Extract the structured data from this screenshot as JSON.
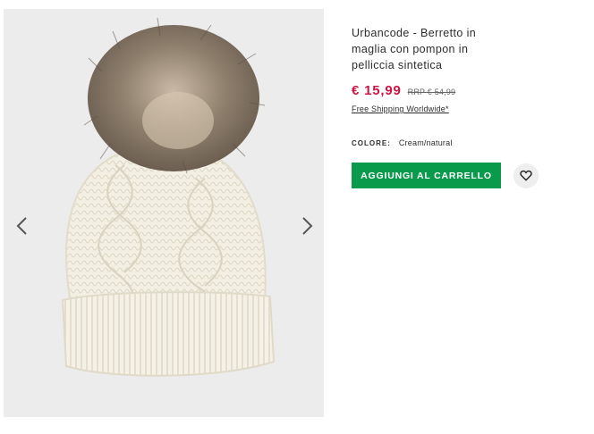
{
  "product": {
    "title_lines": [
      "Urbancode - Berretto in",
      "maglia con pompon in",
      "pelliccia sintetica"
    ],
    "price": "€ 15,99",
    "rrp": "RRP € 54,99",
    "shipping": "Free Shipping Worldwide*",
    "colour_label": "COLORE:",
    "colour_value": "Cream/natural"
  },
  "actions": {
    "add_to_cart": "AGGIUNGI AL CARRELLO"
  },
  "icons": {
    "prev": "chevron-left-icon",
    "next": "chevron-right-icon",
    "save": "heart-icon"
  },
  "colors": {
    "price": "#d01345",
    "button": "#0a9a4c",
    "gallery_bg": "#ececec"
  }
}
